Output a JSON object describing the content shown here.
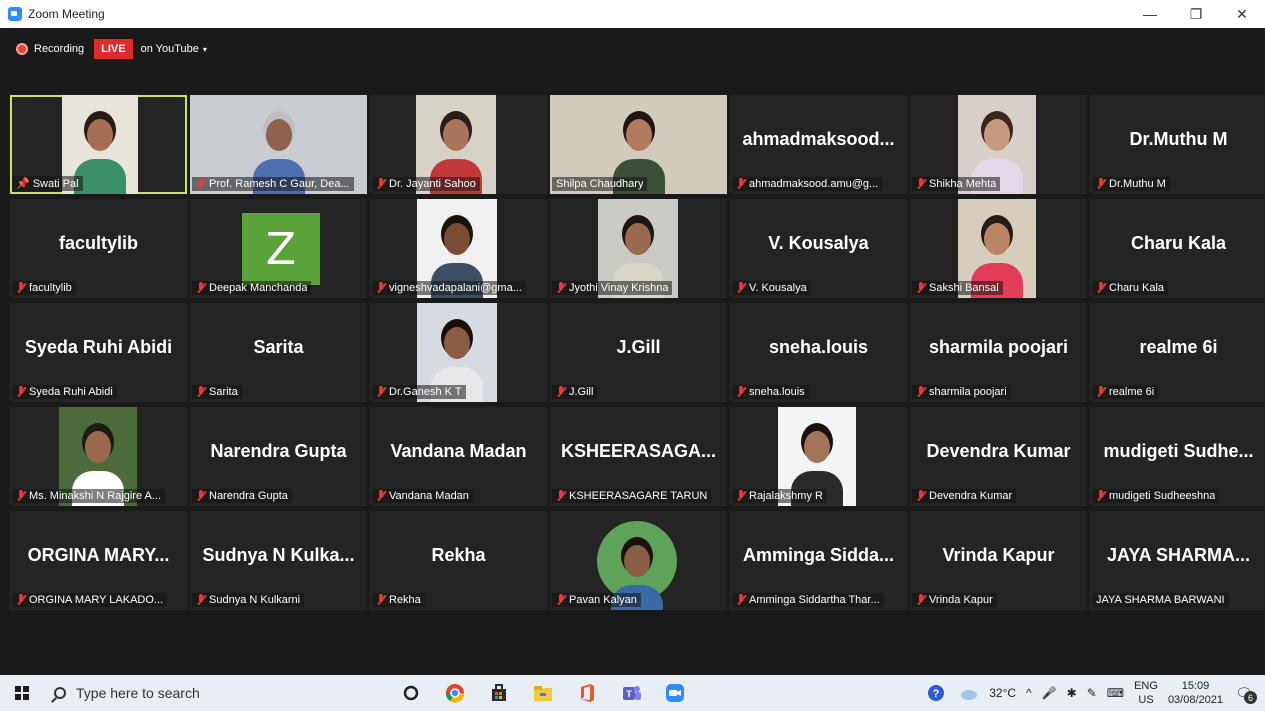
{
  "window": {
    "title": "Zoom Meeting",
    "controls": [
      "—",
      "❐",
      "✕"
    ]
  },
  "recording": {
    "label": "Recording",
    "live": "LIVE",
    "target": "on YouTube",
    "caret": "▾"
  },
  "participants": [
    {
      "display": "",
      "nameplate": "Swati Pal",
      "muted": false,
      "pinned": true,
      "active": true,
      "video": "camera"
    },
    {
      "display": "",
      "nameplate": "Prof. Ramesh C Gaur, Dea...",
      "muted": true,
      "video": "camera"
    },
    {
      "display": "",
      "nameplate": "Dr. Jayanti Sahoo",
      "muted": true,
      "video": "camera"
    },
    {
      "display": "",
      "nameplate": "Shilpa Chaudhary",
      "muted": false,
      "video": "camera"
    },
    {
      "display": "ahmadmaksood...",
      "nameplate": "ahmadmaksood.amu@g...",
      "muted": true
    },
    {
      "display": "",
      "nameplate": "Shikha Mehta",
      "muted": true,
      "video": "camera"
    },
    {
      "display": "Dr.Muthu M",
      "nameplate": "Dr.Muthu M",
      "muted": true
    },
    {
      "display": "facultylib",
      "nameplate": "facultylib",
      "muted": true
    },
    {
      "display": "",
      "nameplate": "Deepak Manchanda",
      "muted": true,
      "video": "avatar",
      "avatar_letter": "Z"
    },
    {
      "display": "",
      "nameplate": "vigneshvadapalani@gma...",
      "muted": true,
      "video": "camera"
    },
    {
      "display": "",
      "nameplate": "Jyothi Vinay Krishna",
      "muted": true,
      "video": "camera"
    },
    {
      "display": "V. Kousalya",
      "nameplate": "V. Kousalya",
      "muted": true
    },
    {
      "display": "",
      "nameplate": "Sakshi Bansal",
      "muted": true,
      "video": "camera"
    },
    {
      "display": "Charu Kala",
      "nameplate": "Charu Kala",
      "muted": true
    },
    {
      "display": "Syeda Ruhi Abidi",
      "nameplate": "Syeda Ruhi Abidi",
      "muted": true
    },
    {
      "display": "Sarita",
      "nameplate": "Sarita",
      "muted": true
    },
    {
      "display": "",
      "nameplate": "Dr.Ganesh K T",
      "muted": true,
      "video": "camera"
    },
    {
      "display": "J.Gill",
      "nameplate": "J.Gill",
      "muted": true
    },
    {
      "display": "sneha.louis",
      "nameplate": "sneha.louis",
      "muted": true
    },
    {
      "display": "sharmila poojari",
      "nameplate": "sharmila poojari",
      "muted": true
    },
    {
      "display": "realme 6i",
      "nameplate": "realme 6i",
      "muted": true
    },
    {
      "display": "",
      "nameplate": "Ms. Minakshi N Rajgire A...",
      "muted": true,
      "video": "camera"
    },
    {
      "display": "Narendra Gupta",
      "nameplate": "Narendra Gupta",
      "muted": true
    },
    {
      "display": "Vandana Madan",
      "nameplate": "Vandana Madan",
      "muted": true
    },
    {
      "display": "KSHEERASAGA...",
      "nameplate": "KSHEERASAGARE TARUN",
      "muted": true
    },
    {
      "display": "",
      "nameplate": "Rajalakshmy R",
      "muted": true,
      "video": "camera"
    },
    {
      "display": "Devendra Kumar",
      "nameplate": "Devendra Kumar",
      "muted": true
    },
    {
      "display": "mudigeti Sudhe...",
      "nameplate": "mudigeti Sudheeshna",
      "muted": true
    },
    {
      "display": "ORGINA MARY...",
      "nameplate": "ORGINA MARY LAKADO...",
      "muted": true
    },
    {
      "display": "Sudnya N Kulka...",
      "nameplate": "Sudnya N Kulkarni",
      "muted": true
    },
    {
      "display": "Rekha",
      "nameplate": "Rekha",
      "muted": true
    },
    {
      "display": "",
      "nameplate": "Pavan Kalyan",
      "muted": true,
      "video": "camera"
    },
    {
      "display": "Amminga Sidda...",
      "nameplate": "Amminga Siddartha Thar...",
      "muted": true
    },
    {
      "display": "Vrinda Kapur",
      "nameplate": "Vrinda Kapur",
      "muted": true
    },
    {
      "display": "JAYA SHARMA...",
      "nameplate": "JAYA SHARMA BARWANI",
      "muted": false
    }
  ],
  "taskbar": {
    "search_placeholder": "Type here to search",
    "apps": [
      "cortana-icon",
      "chrome-icon",
      "store-icon",
      "file-explorer-icon",
      "office-icon",
      "teams-icon",
      "zoom-icon"
    ],
    "temperature": "32°C",
    "lang_top": "ENG",
    "lang_bottom": "US",
    "time": "15:09",
    "date": "03/08/2021",
    "notification_count": "6"
  },
  "colors": {
    "accent_active": "#c8e26c",
    "live": "#e02b2b",
    "muted": "#e03a3a",
    "tile": "#242424",
    "background": "#1a1a1a"
  }
}
